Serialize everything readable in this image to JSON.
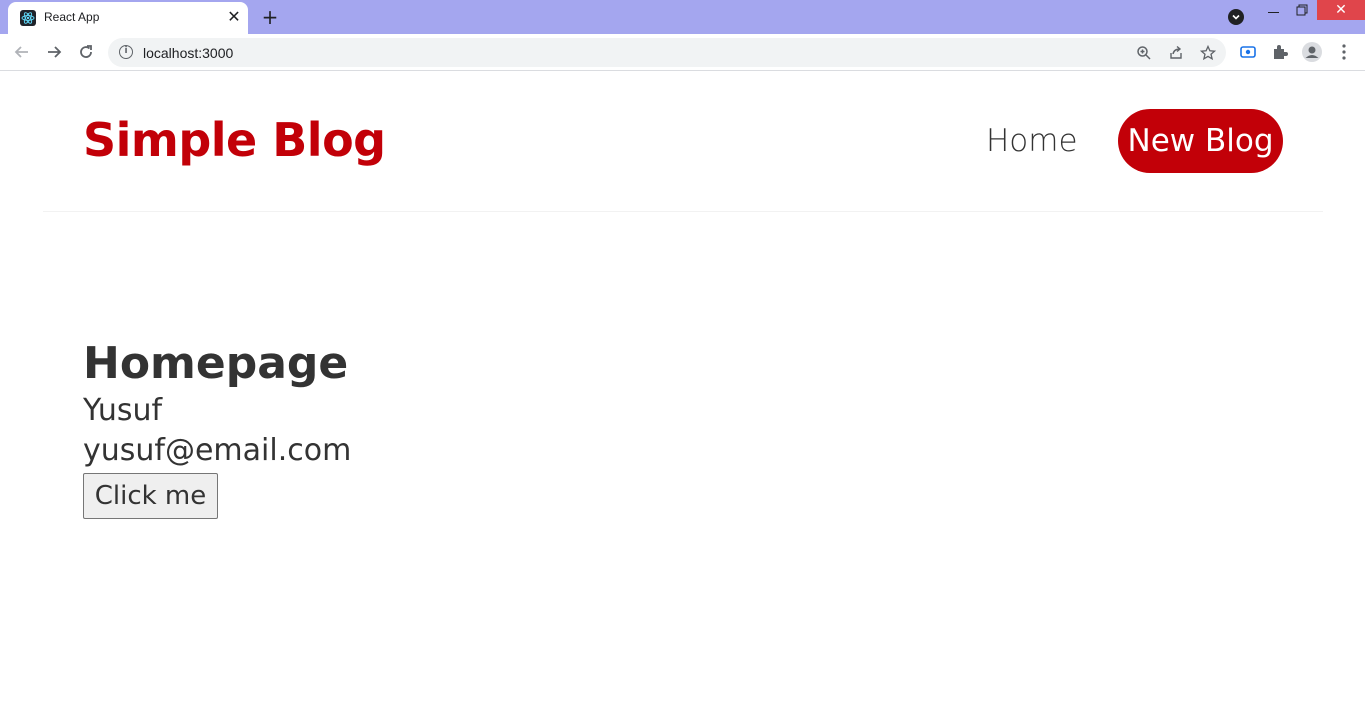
{
  "browser": {
    "tab_title": "React App",
    "tab_close": "✕",
    "new_tab": "+",
    "win_close": "✕",
    "url": "localhost:3000",
    "info": "i"
  },
  "site": {
    "brand": "Simple Blog",
    "nav": {
      "home": "Home",
      "new_blog": "New Blog"
    },
    "colors": {
      "brand": "#c20008"
    }
  },
  "main": {
    "heading": "Homepage",
    "name": "Yusuf",
    "email": "yusuf@email.com",
    "button_label": "Click me"
  }
}
